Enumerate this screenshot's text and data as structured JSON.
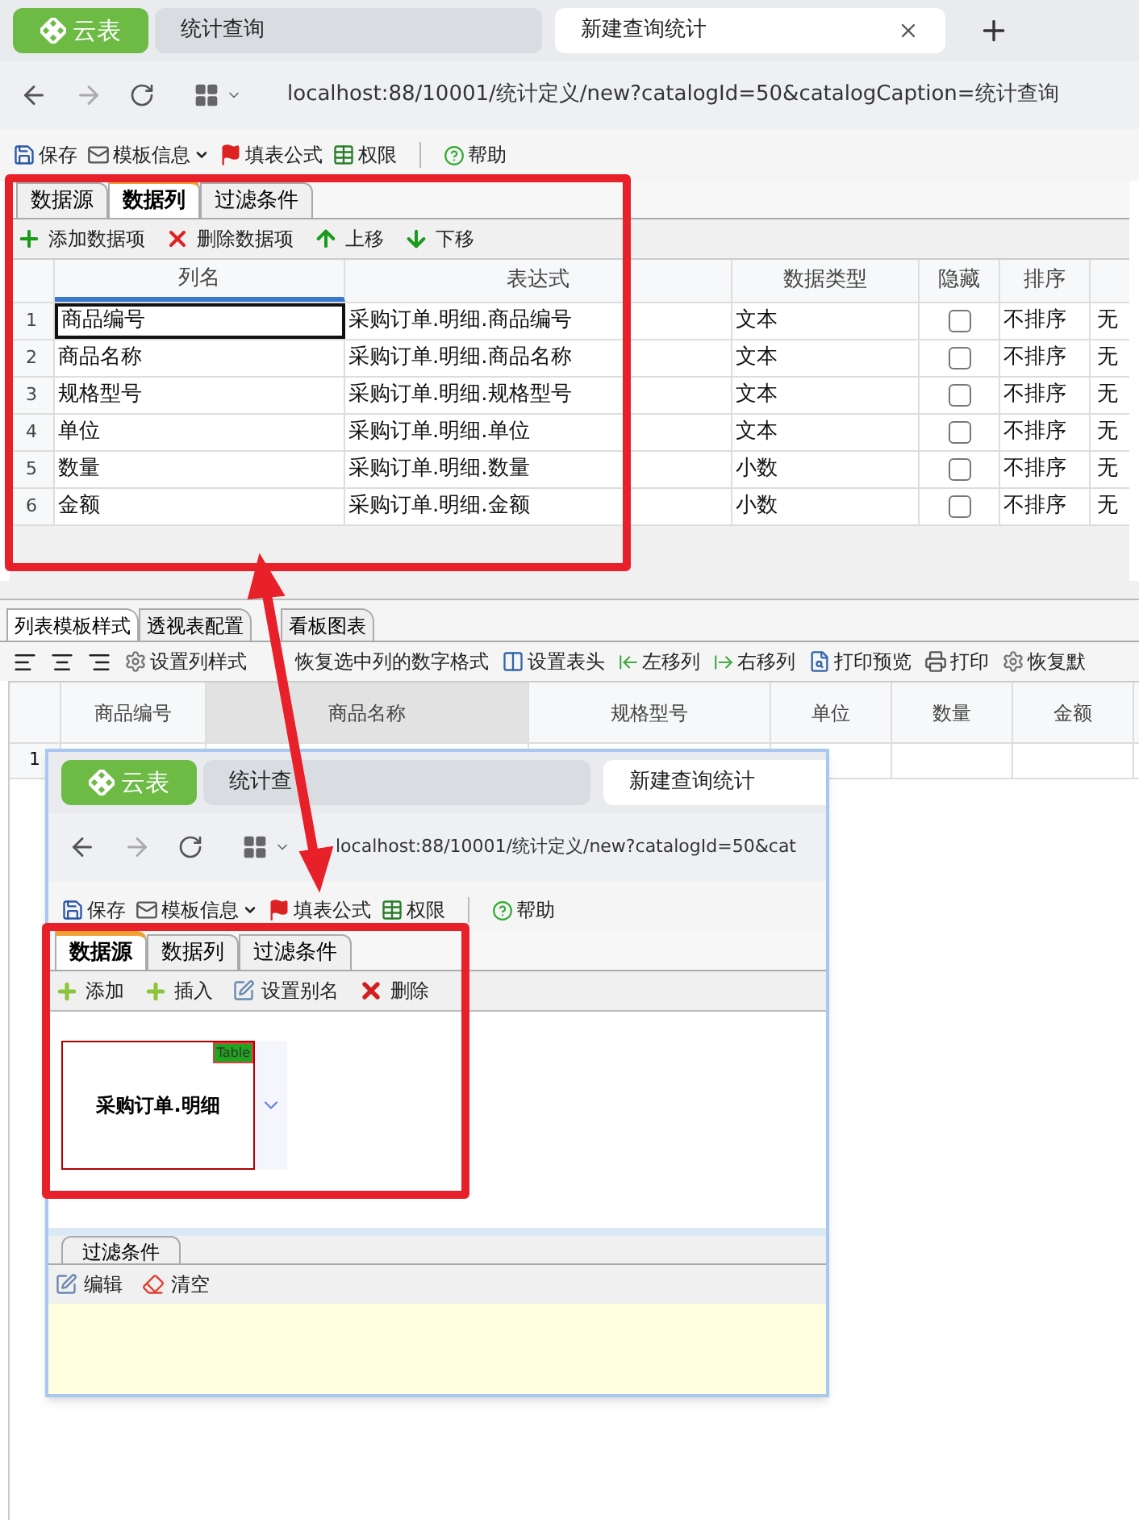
{
  "browser": {
    "logo": "云表",
    "tabs": [
      {
        "label": "统计查询",
        "selected": false
      },
      {
        "label": "新建查询统计",
        "selected": true
      }
    ],
    "url": "localhost:88/10001/统计定义/new?catalogId=50&catalogCaption=统计查询"
  },
  "toolbar": [
    {
      "label": "保存",
      "dropdown": false
    },
    {
      "label": "模板信息",
      "dropdown": true
    },
    {
      "label": "填表公式",
      "dropdown": false
    },
    {
      "label": "权限",
      "dropdown": false
    },
    {
      "label": "帮助",
      "dropdown": false
    }
  ],
  "tabs": [
    {
      "label": "数据源",
      "selected": false
    },
    {
      "label": "数据列",
      "selected": true
    },
    {
      "label": "过滤条件",
      "selected": false
    }
  ],
  "column_toolbar": [
    "添加数据项",
    "删除数据项",
    "上移",
    "下移"
  ],
  "grid": {
    "columns": [
      {
        "label": "列名",
        "selected": true
      },
      {
        "label": "表达式",
        "selected": false
      },
      {
        "label": "数据类型",
        "selected": false
      },
      {
        "label": "隐藏",
        "selected": false
      },
      {
        "label": "排序",
        "selected": false
      }
    ],
    "rows": [
      {
        "num": "1",
        "name": "商品编号",
        "expression": "采购订单.明细.商品编号",
        "type": "文本",
        "hidden": false,
        "sort": "不排序",
        "column_7": "无",
        "selected": true
      },
      {
        "num": "2",
        "name": "商品名称",
        "expression": "采购订单.明细.商品名称",
        "type": "文本",
        "hidden": false,
        "sort": "不排序",
        "column_7": "无",
        "selected": false
      },
      {
        "num": "3",
        "name": "规格型号",
        "expression": "采购订单.明细.规格型号",
        "type": "文本",
        "hidden": false,
        "sort": "不排序",
        "column_7": "无",
        "selected": false
      },
      {
        "num": "4",
        "name": "单位",
        "expression": "采购订单.明细.单位",
        "type": "文本",
        "hidden": false,
        "sort": "不排序",
        "column_7": "无",
        "selected": false
      },
      {
        "num": "5",
        "name": "数量",
        "expression": "采购订单.明细.数量",
        "type": "小数",
        "hidden": false,
        "sort": "不排序",
        "column_7": "无",
        "selected": false
      },
      {
        "num": "6",
        "name": "金额",
        "expression": "采购订单.明细.金额",
        "type": "小数",
        "hidden": false,
        "sort": "不排序",
        "column_7": "无",
        "selected": false
      }
    ]
  },
  "bottom_tabs": [
    {
      "label": "列表模板样式",
      "selected": true
    },
    {
      "label": "透视表配置",
      "selected": false
    },
    {
      "label": "看板图表",
      "selected": false
    }
  ],
  "style_toolbar": [
    "设置列样式",
    "恢复选中列的数字格式",
    "设置表头",
    "左移列",
    "右移列",
    "打印预览",
    "打印",
    "恢复默"
  ],
  "preview": {
    "columns": [
      {
        "label": "商品编号",
        "selected": false
      },
      {
        "label": "商品名称",
        "selected": true
      },
      {
        "label": "规格型号",
        "selected": false
      },
      {
        "label": "单位",
        "selected": false
      },
      {
        "label": "数量",
        "selected": false
      },
      {
        "label": "金额",
        "selected": false
      }
    ],
    "rows": [
      "1"
    ]
  },
  "inset": {
    "browser": {
      "logo": "云表",
      "tabs": [
        {
          "label": "统计查",
          "selected": false
        },
        {
          "label": "新建查询统计",
          "selected": true
        }
      ],
      "url": "localhost:88/10001/统计定义/new?catalogId=50&cat"
    },
    "toolbar": [
      {
        "label": "保存",
        "dropdown": false
      },
      {
        "label": "模板信息",
        "dropdown": true
      },
      {
        "label": "填表公式",
        "dropdown": false
      },
      {
        "label": "权限",
        "dropdown": false
      },
      {
        "label": "帮助",
        "dropdown": false
      }
    ],
    "tabs": [
      {
        "label": "数据源",
        "selected": true
      },
      {
        "label": "数据列",
        "selected": false
      },
      {
        "label": "过滤条件",
        "selected": false
      }
    ],
    "source_toolbar": [
      "添加",
      "插入",
      "设置别名",
      "删除"
    ],
    "table_node": {
      "badge": "Table",
      "name": "采购订单.明细"
    },
    "filter_tab": "过滤条件",
    "filter_toolbar": [
      "编辑",
      "清空"
    ]
  }
}
